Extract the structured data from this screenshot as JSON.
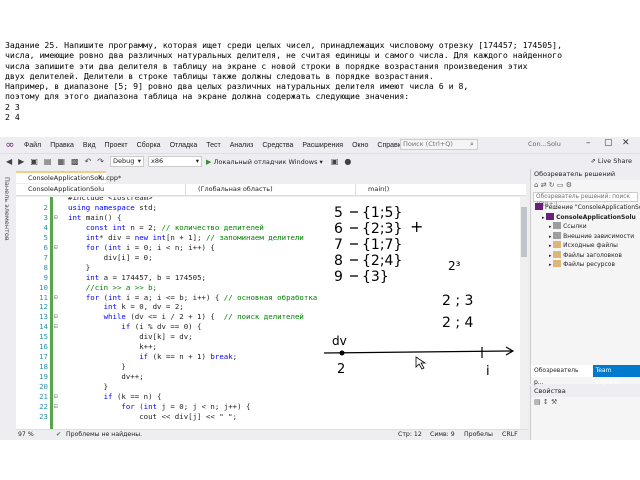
{
  "task": {
    "lines": [
      "Задание 25. Напишите программу, которая ищет среди целых чисел, принадлежащих числовому отрезку [174457; 174505],",
      "числа, имеющие ровно два различных натуральных делителя, не считая единицы и самого числа. Для каждого найденного",
      "числа запишите эти два делителя в таблицу на экране с новой строки в порядке возрастания произведения этих",
      "двух делителей. Делители в строке таблицы также должны следовать в порядке возрастания.",
      "Например, в диапазоне [5; 9] ровно два целых различных натуральных делителя имеют числа 6 и 8,",
      "поэтому для этого диапазона таблица на экране должна содержать следующие значения:",
      "2 3",
      "2 4"
    ]
  },
  "menu": {
    "items": [
      "Файл",
      "Правка",
      "Вид",
      "Проект",
      "Сборка",
      "Отладка",
      "Тест",
      "Анализ",
      "Средства",
      "Расширения",
      "Окно",
      "Справка"
    ],
    "search_placeholder": "Поиск (Ctrl+Q)",
    "window_title": "Con...Solu"
  },
  "toolbar": {
    "config": "Debug",
    "platform": "x86",
    "run_label": "Локальный отладчик Windows",
    "live_share": "Live Share"
  },
  "left_tab": "Панель элементов",
  "editor": {
    "tab_title": "ConsoleApplicationSolu.cpp*",
    "nav_project": "ConsoleApplicationSolu",
    "nav_scope": "(Глобальная область)",
    "nav_member": "main()",
    "lines": [
      {
        "n": "",
        "segs": [
          {
            "t": "#include <iostream>",
            "c": ""
          }
        ]
      },
      {
        "n": "2",
        "segs": [
          {
            "t": "using ",
            "c": "kw"
          },
          {
            "t": "namespace ",
            "c": "kw"
          },
          {
            "t": "std;",
            "c": ""
          }
        ]
      },
      {
        "n": "3",
        "segs": [
          {
            "t": "int ",
            "c": "kw"
          },
          {
            "t": "main() {",
            "c": ""
          }
        ]
      },
      {
        "n": "4",
        "segs": [
          {
            "t": "    ",
            "c": ""
          },
          {
            "t": "const int ",
            "c": "kw"
          },
          {
            "t": "n = 2; ",
            "c": ""
          },
          {
            "t": "// количество делителей",
            "c": "cm"
          }
        ]
      },
      {
        "n": "5",
        "segs": [
          {
            "t": "    ",
            "c": ""
          },
          {
            "t": "int",
            "c": "kw"
          },
          {
            "t": "* div = ",
            "c": ""
          },
          {
            "t": "new int",
            "c": "kw"
          },
          {
            "t": "[n + 1]; ",
            "c": ""
          },
          {
            "t": "// запоминаем делители",
            "c": "cm"
          }
        ]
      },
      {
        "n": "6",
        "segs": [
          {
            "t": "    ",
            "c": ""
          },
          {
            "t": "for ",
            "c": "kw"
          },
          {
            "t": "(",
            "c": ""
          },
          {
            "t": "int ",
            "c": "kw"
          },
          {
            "t": "i = 0; i < n; i++) {",
            "c": ""
          }
        ]
      },
      {
        "n": "7",
        "segs": [
          {
            "t": "        div[i] = 0;",
            "c": ""
          }
        ]
      },
      {
        "n": "8",
        "segs": [
          {
            "t": "    }",
            "c": ""
          }
        ]
      },
      {
        "n": "9",
        "segs": [
          {
            "t": "    ",
            "c": ""
          },
          {
            "t": "int ",
            "c": "kw"
          },
          {
            "t": "a = 174457, b = 174505;",
            "c": ""
          }
        ]
      },
      {
        "n": "10",
        "segs": [
          {
            "t": "    //cin >> a >> b;",
            "c": "cm"
          }
        ]
      },
      {
        "n": "11",
        "segs": [
          {
            "t": "    ",
            "c": ""
          },
          {
            "t": "for ",
            "c": "kw"
          },
          {
            "t": "(",
            "c": ""
          },
          {
            "t": "int ",
            "c": "kw"
          },
          {
            "t": "i = a; i <= b; i++) { ",
            "c": ""
          },
          {
            "t": "// основная обработка",
            "c": "cm"
          }
        ]
      },
      {
        "n": "12",
        "segs": [
          {
            "t": "        ",
            "c": ""
          },
          {
            "t": "int ",
            "c": "kw"
          },
          {
            "t": "k = 0, dv = 2;",
            "c": ""
          }
        ]
      },
      {
        "n": "13",
        "segs": [
          {
            "t": "        ",
            "c": ""
          },
          {
            "t": "while ",
            "c": "kw"
          },
          {
            "t": "(dv <= i / 2 + 1) {  ",
            "c": ""
          },
          {
            "t": "// поиск делителей",
            "c": "cm"
          }
        ]
      },
      {
        "n": "14",
        "segs": [
          {
            "t": "            ",
            "c": ""
          },
          {
            "t": "if ",
            "c": "kw"
          },
          {
            "t": "(i % dv == 0) {",
            "c": ""
          }
        ]
      },
      {
        "n": "15",
        "segs": [
          {
            "t": "                div[k] = dv;",
            "c": ""
          }
        ]
      },
      {
        "n": "16",
        "segs": [
          {
            "t": "                k++;",
            "c": ""
          }
        ]
      },
      {
        "n": "17",
        "segs": [
          {
            "t": "                ",
            "c": ""
          },
          {
            "t": "if ",
            "c": "kw"
          },
          {
            "t": "(k == n + 1) ",
            "c": ""
          },
          {
            "t": "break",
            "c": "kw"
          },
          {
            "t": ";",
            "c": ""
          }
        ]
      },
      {
        "n": "18",
        "segs": [
          {
            "t": "            }",
            "c": ""
          }
        ]
      },
      {
        "n": "19",
        "segs": [
          {
            "t": "            dv++;",
            "c": ""
          }
        ]
      },
      {
        "n": "20",
        "segs": [
          {
            "t": "        }",
            "c": ""
          }
        ]
      },
      {
        "n": "21",
        "segs": [
          {
            "t": "        ",
            "c": ""
          },
          {
            "t": "if ",
            "c": "kw"
          },
          {
            "t": "(k == n) {",
            "c": ""
          }
        ]
      },
      {
        "n": "22",
        "segs": [
          {
            "t": "            ",
            "c": ""
          },
          {
            "t": "for ",
            "c": "kw"
          },
          {
            "t": "(",
            "c": ""
          },
          {
            "t": "int ",
            "c": "kw"
          },
          {
            "t": "j = 0; j < n; j++) {",
            "c": ""
          }
        ]
      },
      {
        "n": "23",
        "segs": [
          {
            "t": "                cout << div[j] << \" \";",
            "c": ""
          }
        ]
      }
    ]
  },
  "ink": {
    "rows": [
      "5",
      "6",
      "7",
      "8",
      "9"
    ],
    "sets": [
      "{1;5}",
      "{2;3}",
      "{1;7}",
      "{2;4}",
      "{3}"
    ],
    "plus": "+",
    "power": "2³",
    "pair1": "2 ; 3",
    "pair2": "2 ; 4",
    "label_dv": "dv",
    "label_2": "2",
    "label_i": "i"
  },
  "status": {
    "zoom": "97 %",
    "problems": "Проблемы не найдены.",
    "line": "Стр: 12",
    "col": "Симв: 9",
    "spaces": "Пробелы",
    "eol": "CRLF"
  },
  "solution": {
    "title": "Обозреватель решений",
    "search": "Обозреватель решений: поиск (Ctrl+;)",
    "nodes": [
      {
        "label": "Решение \"ConsoleApplicationSolu\"",
        "indent": 0
      },
      {
        "label": "ConsoleApplicationSolu",
        "indent": 1
      },
      {
        "label": "Ссылки",
        "indent": 2
      },
      {
        "label": "Внешние зависимости",
        "indent": 2
      },
      {
        "label": "Исходные файлы",
        "indent": 2
      },
      {
        "label": "Файлы заголовков",
        "indent": 2
      },
      {
        "label": "Файлы ресурсов",
        "indent": 2
      }
    ],
    "tab1": "Обозреватель р...",
    "tab2": "Team Explorer"
  },
  "properties": {
    "title": "Свойства"
  },
  "colors": {
    "ide_bg": "#eeeef2",
    "keyword": "#0000ff",
    "comment": "#008000",
    "line_number": "#2b91af",
    "vs_purple": "#68217a",
    "tab_accent": "#f5cc84",
    "tab_active": "#007acc"
  }
}
